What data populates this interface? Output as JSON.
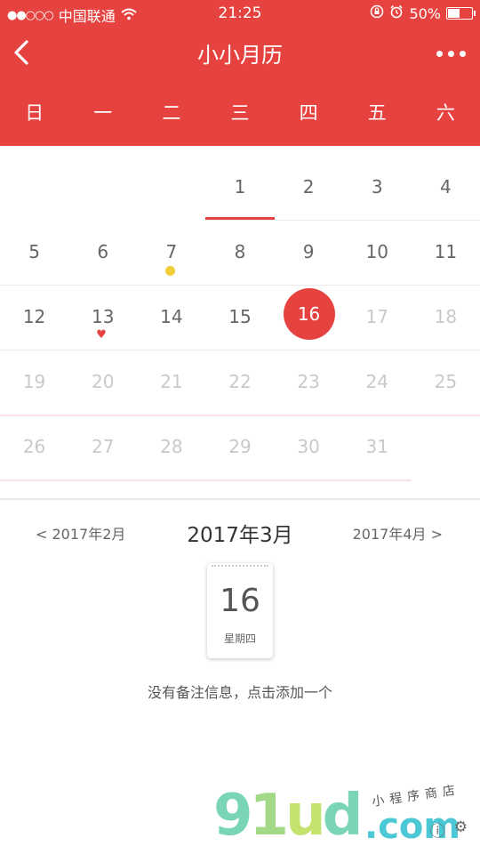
{
  "status_bar": {
    "signal": "●●○○○",
    "carrier": "中国联通",
    "time": "21:25",
    "battery_text": "50%",
    "battery_level": 0.5
  },
  "nav": {
    "title": "小小月历"
  },
  "weekdays": [
    "日",
    "一",
    "二",
    "三",
    "四",
    "五",
    "六"
  ],
  "calendar": {
    "rows": [
      [
        "",
        "",
        "",
        "1",
        "2",
        "3",
        "4"
      ],
      [
        "5",
        "6",
        "7",
        "8",
        "9",
        "10",
        "11"
      ],
      [
        "12",
        "13",
        "14",
        "15",
        "16",
        "17",
        "18"
      ],
      [
        "19",
        "20",
        "21",
        "22",
        "23",
        "24",
        "25"
      ],
      [
        "26",
        "27",
        "28",
        "29",
        "30",
        "31",
        ""
      ]
    ],
    "selected_day": "16",
    "today": "1",
    "marked_dot_day": "7",
    "marked_heart_day": "13"
  },
  "month_nav": {
    "prev": "< 2017年2月",
    "current": "2017年3月",
    "next": "2017年4月 >"
  },
  "day_card": {
    "day": "16",
    "weekday": "星期四"
  },
  "note_text": "没有备注信息，点击添加一个",
  "watermark": {
    "big": [
      "9",
      "1",
      "u",
      "d"
    ],
    "com": ".com",
    "small": "小程序商店"
  },
  "colors": {
    "accent": "#e64340",
    "dot": "#f0cd3a"
  }
}
